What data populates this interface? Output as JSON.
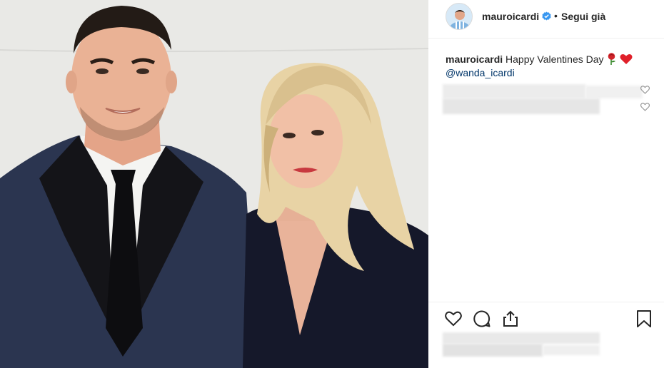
{
  "post": {
    "username": "mauroicardi",
    "separator": "•",
    "follow_label": "Segui già",
    "caption_text": "Happy Valentines Day",
    "caption_mention": "@wanda_icardi",
    "caption_emojis": [
      "rose-emoji",
      "red-heart-emoji"
    ]
  },
  "icons": {
    "verified": "verified-badge-icon",
    "like": "heart-icon",
    "comment": "comment-icon",
    "share": "share-icon",
    "save": "bookmark-icon",
    "comment_like": "small-heart-icon"
  },
  "colors": {
    "text": "#262626",
    "verified_blue": "#3897f0",
    "mention": "#003569",
    "divider": "#efefef"
  }
}
